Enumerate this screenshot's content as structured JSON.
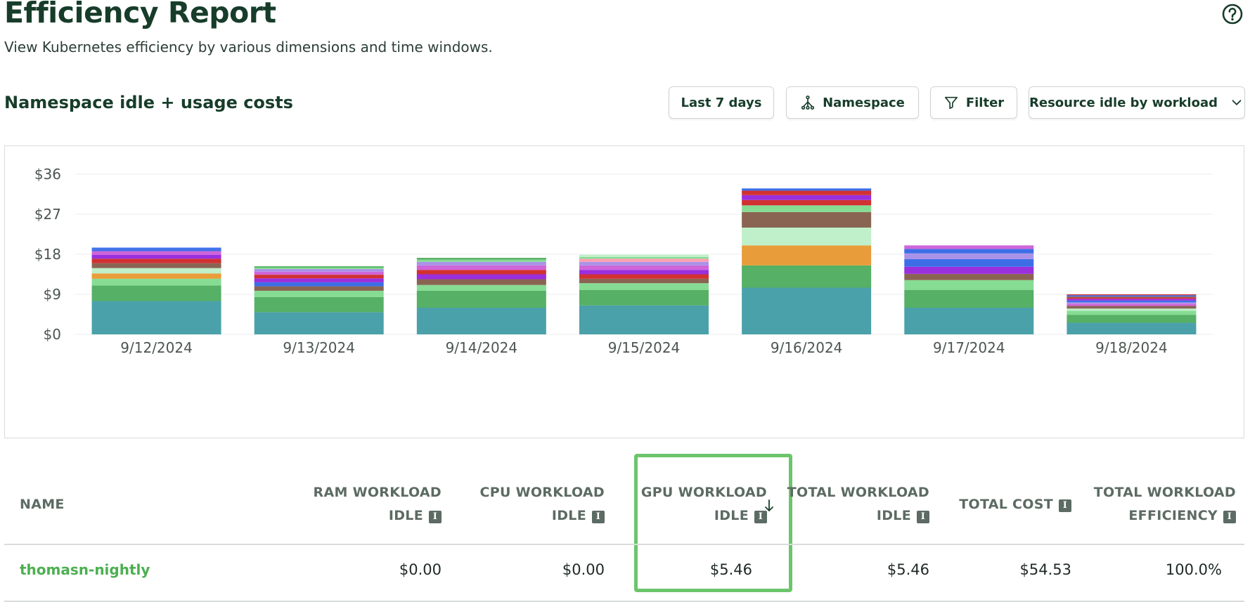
{
  "header": {
    "title": "Efficiency Report",
    "subtitle": "View Kubernetes efficiency by various dimensions and time windows."
  },
  "section": {
    "title": "Namespace idle + usage costs"
  },
  "toolbar": {
    "range_label": "Last 7 days",
    "aggregate_label": "Namespace",
    "filter_label": "Filter",
    "view_select_label": "Resource idle by workload"
  },
  "icons": {
    "help": "help-icon",
    "aggregate": "share-nodes-icon",
    "filter": "filter-icon",
    "select": "chevron-down-icon",
    "info": "info-icon",
    "sort": "arrow-down-icon"
  },
  "chart_data": {
    "type": "bar",
    "stacked": true,
    "categories": [
      "9/12/2024",
      "9/13/2024",
      "9/14/2024",
      "9/15/2024",
      "9/16/2024",
      "9/17/2024",
      "9/18/2024"
    ],
    "ylim": [
      0,
      36
    ],
    "yticks": [
      0,
      9,
      18,
      27,
      36
    ],
    "ytick_labels": [
      "$0",
      "$9",
      "$18",
      "$27",
      "$36"
    ],
    "grid": true,
    "legend": "none",
    "colors": [
      "#4aa1aa",
      "#56b065",
      "#86dc93",
      "#e89d3a",
      "#bff0c9",
      "#8a6453",
      "#d23131",
      "#9a2fdd",
      "#3d6ee8",
      "#cf65d9",
      "#ff9fb0",
      "#a993e8",
      "#f4b8e0"
    ],
    "stacks": [
      [
        7.5,
        3.5,
        1.5,
        1.2,
        1.2,
        1.1,
        1.0,
        0.9,
        0.8,
        0.5,
        0.3
      ],
      [
        5.0,
        3.4,
        1.4,
        1.0,
        0.9,
        0.9,
        0.8,
        0.7,
        0.6,
        0.3,
        0.3
      ],
      [
        6.0,
        3.8,
        1.3,
        1.3,
        1.1,
        1.0,
        1.0,
        0.8,
        0.5,
        0.4
      ],
      [
        6.5,
        3.5,
        1.5,
        1.0,
        1.0,
        1.0,
        1.0,
        0.8,
        0.7,
        0.4,
        0.5
      ],
      [
        10.5,
        5.0,
        0.0,
        4.5,
        4.0,
        3.5,
        1.5,
        1.2,
        1.1,
        1.0,
        0.5
      ],
      [
        6.0,
        4.0,
        2.2,
        0.0,
        1.4,
        1.6,
        0.0,
        1.7,
        1.3,
        1.0,
        0.8
      ],
      [
        2.6,
        1.8,
        0.9,
        0.5,
        0.6,
        0.5,
        0.3,
        0.4,
        0.4,
        0.3,
        0.2,
        0.3,
        0.2
      ]
    ],
    "stack_color_index": [
      [
        0,
        1,
        2,
        3,
        4,
        5,
        6,
        7,
        9,
        8,
        8
      ],
      [
        0,
        1,
        2,
        5,
        8,
        7,
        6,
        9,
        11,
        2,
        1
      ],
      [
        0,
        1,
        2,
        5,
        7,
        6,
        9,
        11,
        2,
        1
      ],
      [
        0,
        1,
        2,
        5,
        6,
        7,
        9,
        11,
        10,
        2,
        4
      ],
      [
        0,
        1,
        1,
        3,
        4,
        5,
        2,
        6,
        7,
        6,
        8
      ],
      [
        0,
        1,
        2,
        2,
        5,
        7,
        7,
        8,
        11,
        8,
        9
      ],
      [
        0,
        1,
        2,
        4,
        5,
        9,
        11,
        8,
        7,
        6,
        5,
        8,
        6
      ]
    ]
  },
  "table": {
    "columns": [
      {
        "line1": "NAME",
        "line2": ""
      },
      {
        "line1": "RAM WORKLOAD",
        "line2": "IDLE"
      },
      {
        "line1": "CPU WORKLOAD",
        "line2": "IDLE"
      },
      {
        "line1": "GPU WORKLOAD",
        "line2": "IDLE"
      },
      {
        "line1": "TOTAL WORKLOAD",
        "line2": "IDLE"
      },
      {
        "line1": "TOTAL COST",
        "line2": ""
      },
      {
        "line1": "TOTAL WORKLOAD",
        "line2": "EFFICIENCY"
      }
    ],
    "rows": [
      {
        "name": "thomasn-nightly",
        "ram_idle": "$0.00",
        "cpu_idle": "$0.00",
        "gpu_idle": "$5.46",
        "total_idle": "$5.46",
        "total_cost": "$54.53",
        "efficiency": "100.0%"
      }
    ],
    "sorted_column": "GPU WORKLOAD IDLE"
  }
}
